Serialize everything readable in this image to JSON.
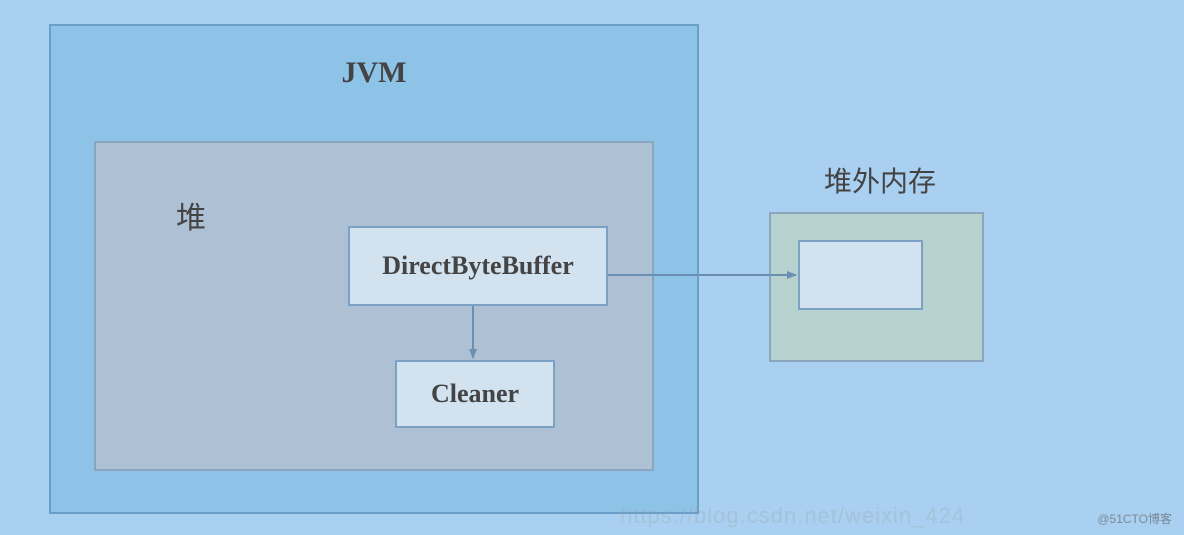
{
  "jvm": {
    "title": "JVM"
  },
  "heap": {
    "title": "堆"
  },
  "directByteBuffer": {
    "label": "DirectByteBuffer"
  },
  "cleaner": {
    "label": "Cleaner"
  },
  "offHeap": {
    "label": "堆外内存"
  },
  "watermark": "@51CTO博客",
  "fadedUrl": "https://blog.csdn.net/weixin_424"
}
